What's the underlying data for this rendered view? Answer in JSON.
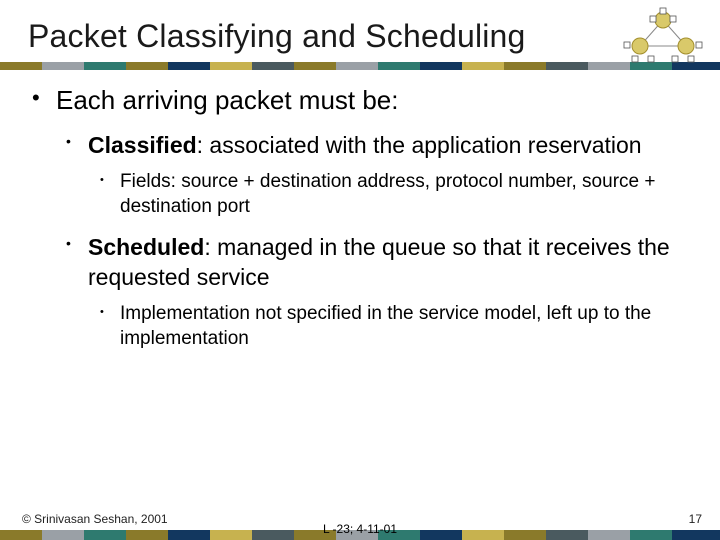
{
  "title": "Packet Classifying and Scheduling",
  "bullets": {
    "l1": "Each arriving packet must be:",
    "classified_term": "Classified",
    "classified_rest": ": associated with the application reservation",
    "classified_sub": "Fields: source + destination address, protocol number, source + destination port",
    "scheduled_term": "Scheduled",
    "scheduled_rest": ": managed in the queue so that it receives the requested service",
    "scheduled_sub": "Implementation not specified in the service model, left up to the implementation"
  },
  "footer": {
    "left": "© Srinivasan Seshan, 2001",
    "center": "L -23; 4-11-01",
    "right": "17"
  },
  "palette": {
    "olive": "#8a7a2a",
    "teal": "#2e7a6f",
    "gray": "#9aa0a6",
    "navy": "#12375f",
    "tan": "#c7b24f",
    "slate": "#4a5a5f"
  }
}
